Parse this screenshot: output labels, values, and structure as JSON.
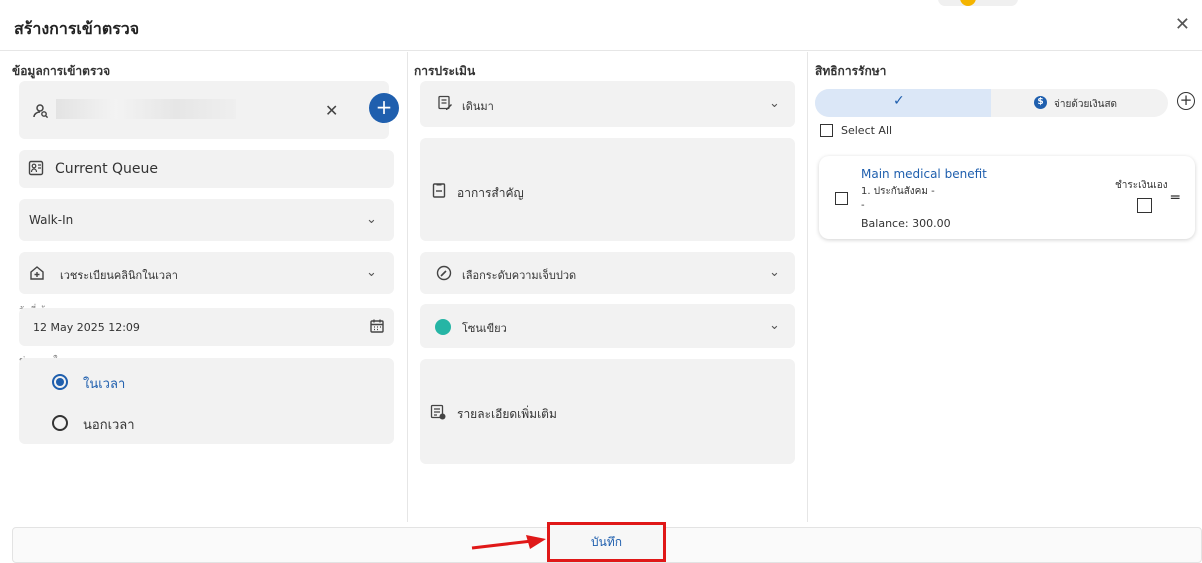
{
  "header": {
    "title": "สร้างการเข้าตรวจ",
    "close_icon": "close-icon"
  },
  "left": {
    "section_title": "ข้อมูลการเข้าตรวจ",
    "patient_search_icon": "person-search-icon",
    "clear_icon": "clear-icon",
    "add_icon": "add-circle-icon",
    "queue_label": "Current Queue",
    "visit_type": "Walk-In",
    "clinic_select": "เวชระเบียนคลินิกในเวลา",
    "visit_date_caption": "วันที่เข้าตรวจ",
    "visit_date": "12 May 2025 12:09",
    "time_caption": "ช่วงเวลาในการมา",
    "time_options": [
      {
        "label": "ในเวลา",
        "selected": true
      },
      {
        "label": "นอกเวลา",
        "selected": false
      }
    ]
  },
  "middle": {
    "section_title": "การประเมิน",
    "arrival_select": "เดินมา",
    "vital_signs_label": "อาการสำคัญ",
    "pain_level_select": "เลือกระดับความเจ็บปวด",
    "zone_select": "โซนเขียว",
    "zone_color": "#26b5a5",
    "details_label": "รายละเอียดเพิ่มเติม"
  },
  "right": {
    "section_title": "สิทธิการรักษา",
    "toggle_left_icon": "check-icon",
    "toggle_right_label": "จ่ายด้วยเงินสด",
    "toggle_right_icon": "dollar-circle-icon",
    "add_icon": "add-circle-outline-icon",
    "select_all_label": "Select All",
    "benefit": {
      "title": "Main medical benefit",
      "line1": "1. ประกันสังคม -",
      "line2": "-",
      "balance": "Balance: 300.00",
      "self_pay_label": "ชำระเงินเอง"
    }
  },
  "footer": {
    "save_label": "บันทึก"
  },
  "colors": {
    "accent": "#1f5fae",
    "highlight": "#e01818"
  }
}
